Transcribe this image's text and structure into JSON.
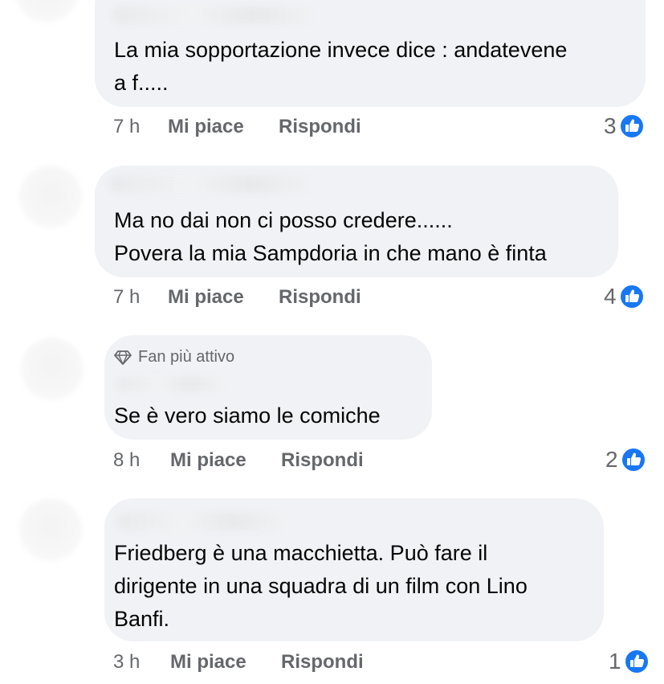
{
  "comments": [
    {
      "text": "La mia sopportazione invece dice : andatevene\na f.....",
      "time": "7 h",
      "like_label": "Mi piace",
      "reply_label": "Rispondi",
      "reactions_count": "3",
      "badge": null
    },
    {
      "text": "Ma no dai non ci posso credere......\nPovera la mia Sampdoria in che mano è finta",
      "time": "7 h",
      "like_label": "Mi piace",
      "reply_label": "Rispondi",
      "reactions_count": "4",
      "badge": null
    },
    {
      "text": "Se è vero siamo le comiche",
      "time": "8 h",
      "like_label": "Mi piace",
      "reply_label": "Rispondi",
      "reactions_count": "2",
      "badge": "Fan più attivo"
    },
    {
      "text": "Friedberg è una macchietta. Può fare il\ndirigente in una squadra di un film con Lino\nBanfi.",
      "time": "3 h",
      "like_label": "Mi piace",
      "reply_label": "Rispondi",
      "reactions_count": "1",
      "badge": null
    }
  ],
  "colors": {
    "bubble": "#f0f2f5",
    "meta_text": "#65676b",
    "like_blue": "#1877f2"
  },
  "icons": {
    "reaction": "like-thumbs-up-icon",
    "badge": "diamond-icon"
  }
}
